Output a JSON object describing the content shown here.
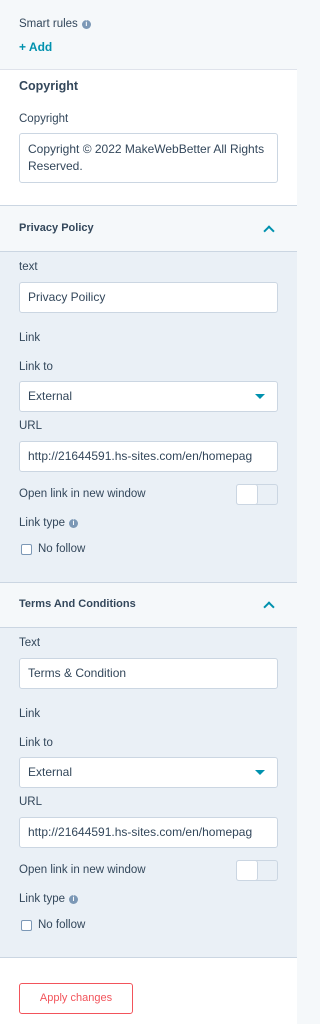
{
  "smart_rules": {
    "label": "Smart rules",
    "add_label": "+ Add"
  },
  "copyright_section": {
    "title": "Copyright",
    "field_label": "Copyright",
    "value": "Copyright © 2022 MakeWebBetter All Rights Reserved."
  },
  "privacy": {
    "title": "Privacy Policy",
    "text_label": "text",
    "text_value": "Privacy Poilicy",
    "link_heading": "Link",
    "link_to_label": "Link to",
    "link_to_value": "External",
    "url_label": "URL",
    "url_value": "http://21644591.hs-sites.com/en/homepag",
    "new_window_label": "Open link in new window",
    "new_window_on": false,
    "link_type_label": "Link type",
    "no_follow_label": "No follow",
    "no_follow_checked": false
  },
  "terms": {
    "title": "Terms And Conditions",
    "text_label": "Text",
    "text_value": "Terms & Condition",
    "link_heading": "Link",
    "link_to_label": "Link to",
    "link_to_value": "External",
    "url_label": "URL",
    "url_value": "http://21644591.hs-sites.com/en/homepag",
    "new_window_label": "Open link in new window",
    "new_window_on": false,
    "link_type_label": "Link type",
    "no_follow_label": "No follow",
    "no_follow_checked": false
  },
  "footer": {
    "apply_label": "Apply changes"
  },
  "colors": {
    "accent": "#0091ae",
    "apply": "#f2545b",
    "panel": "#eaf0f6"
  }
}
